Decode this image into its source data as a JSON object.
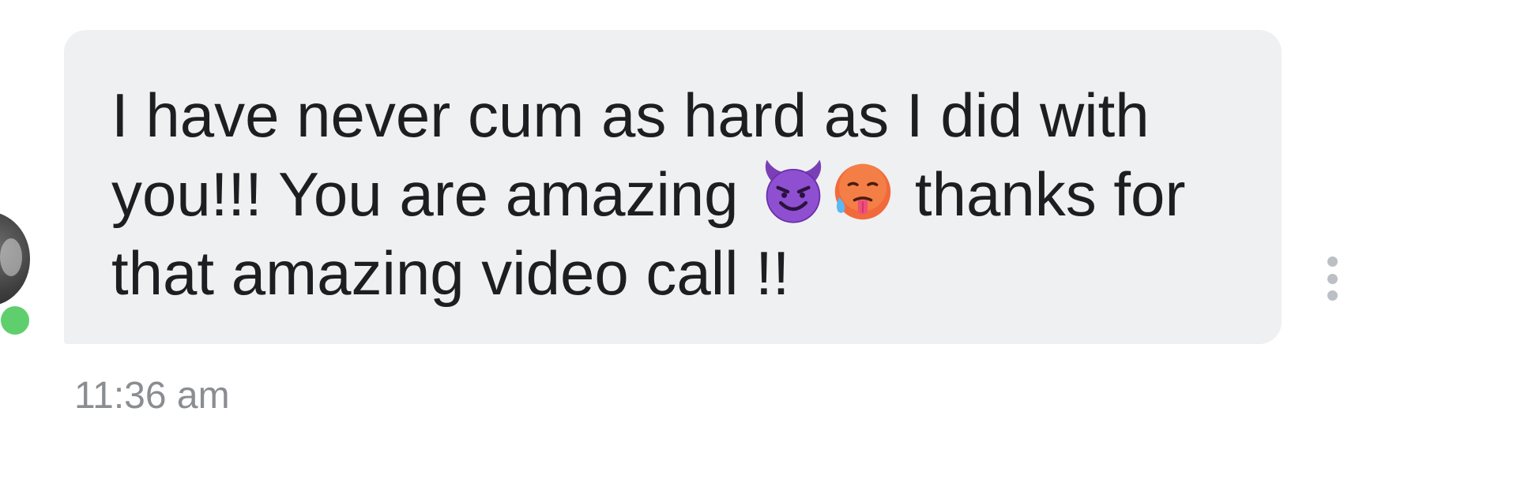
{
  "message": {
    "line1": "I have never cum as hard as I did with",
    "line2_start": "you!!! You are amazing",
    "emoji_1": "smiling-devil-icon",
    "emoji_2": "hot-face-icon",
    "line2_end": "thanks for",
    "line3": "that amazing video call !!"
  },
  "timestamp": "11:36 am",
  "sender": {
    "online": true
  },
  "colors": {
    "bubble_background": "#eff0f2",
    "message_text": "#1c1e21",
    "timestamp_text": "#8a8d91",
    "online_indicator": "#5fcf6d",
    "options_dots": "#bcc0c4"
  }
}
